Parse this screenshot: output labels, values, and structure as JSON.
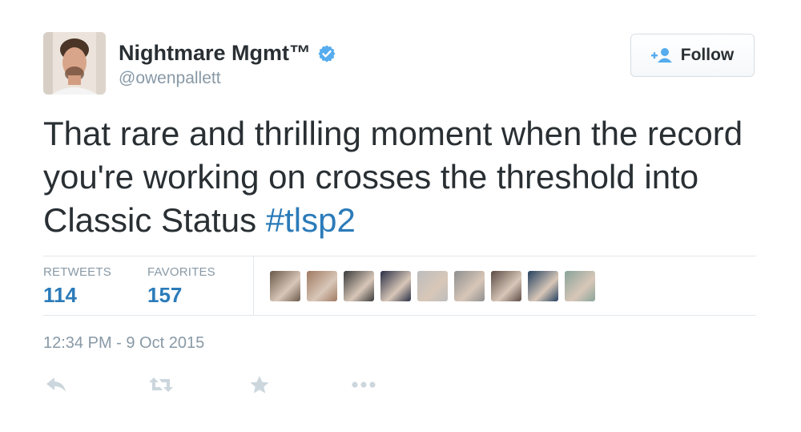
{
  "user": {
    "display_name": "Nightmare Mgmt™",
    "handle": "@owenpallett",
    "verified": true
  },
  "follow_button": {
    "label": "Follow"
  },
  "tweet": {
    "text": "That rare and thrilling moment when the record you're working on crosses the threshold into Classic Status ",
    "hashtag": "#tlsp2"
  },
  "stats": {
    "retweets_label": "RETWEETS",
    "retweets_count": "114",
    "favorites_label": "FAVORITES",
    "favorites_count": "157"
  },
  "favoriter_avatars": [
    {
      "color": "#6b5a4a"
    },
    {
      "color": "#a07a62"
    },
    {
      "color": "#3a3a3a"
    },
    {
      "color": "#2a2f45"
    },
    {
      "color": "#bdbdbd"
    },
    {
      "color": "#8f8f8f"
    },
    {
      "color": "#5b4b45"
    },
    {
      "color": "#24405f"
    },
    {
      "color": "#8aa39a"
    }
  ],
  "timestamp": "12:34 PM - 9 Oct 2015",
  "actions": [
    "reply",
    "retweet",
    "favorite",
    "more"
  ],
  "colors": {
    "link": "#2b7bb9",
    "verified": "#55acee",
    "muted": "#8899a6",
    "text": "#292f33",
    "action_icon": "#ccd6dd"
  }
}
